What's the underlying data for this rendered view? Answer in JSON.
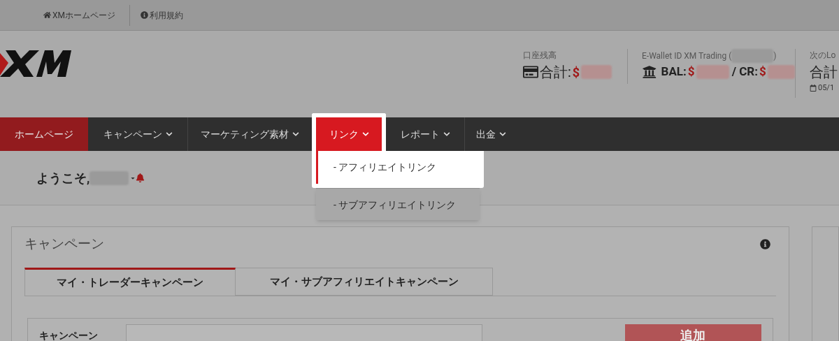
{
  "top_bar": {
    "links": [
      {
        "kind": "home",
        "label": "XMホームページ"
      },
      {
        "kind": "info",
        "label": "利用規約"
      }
    ]
  },
  "header": {
    "balance": {
      "label": "口座残高",
      "total_label": "合計:",
      "currency": "$"
    },
    "wallet": {
      "label": "E-Wallet ID XM Trading (",
      "label_end": ")",
      "bal_label": "BAL:",
      "cr_label": "/ CR:",
      "currency": "$"
    },
    "next_lot": {
      "label": "次のLo",
      "total_label": "合計",
      "date": "05/1"
    }
  },
  "nav": [
    {
      "label": "ホームページ",
      "selected": true,
      "expanded": false,
      "has_caret": false
    },
    {
      "label": "キャンペーン",
      "selected": false,
      "expanded": false,
      "has_caret": true
    },
    {
      "label": "マーケティング素材",
      "selected": false,
      "expanded": false,
      "has_caret": true
    },
    {
      "label": "リンク",
      "selected": false,
      "expanded": true,
      "has_caret": true,
      "menu": [
        {
          "label": "- アフィリエイトリンク",
          "highlighted": true
        },
        {
          "label": "- サブアフィリエイトリンク",
          "highlighted": false
        }
      ]
    },
    {
      "label": "レポート",
      "selected": false,
      "expanded": false,
      "has_caret": true
    },
    {
      "label": "出金",
      "selected": false,
      "expanded": false,
      "has_caret": true
    }
  ],
  "welcome": {
    "text": "ようこそ,"
  },
  "campaign_panel": {
    "title": "キャンペーン",
    "tabs": [
      {
        "label": "マイ・トレーダーキャンペーン",
        "selected": true
      },
      {
        "label": "マイ・サブアフィリエイトキャンペーン",
        "selected": false
      }
    ],
    "form": {
      "field_label": "キャンペーン",
      "button": "追加"
    }
  }
}
